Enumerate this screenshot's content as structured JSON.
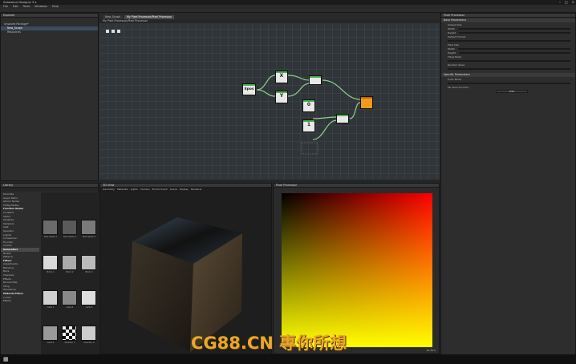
{
  "window": {
    "title": "Substance Designer 5.x"
  },
  "menu": [
    "File",
    "Edit",
    "Tools",
    "Windows",
    "Help"
  ],
  "explorer": {
    "title": "Explorer",
    "items": [
      {
        "label": "Unsaved Package*",
        "selected": false
      },
      {
        "label": "New_Graph",
        "selected": true
      },
      {
        "label": "Resources",
        "selected": false
      }
    ]
  },
  "graph": {
    "tabs": [
      {
        "label": "New_Graph",
        "active": false
      },
      {
        "label": "My Pixel Processor/Pixel Processor",
        "active": true
      }
    ],
    "subtitle": "My Pixel Processor/Pixel Processor",
    "nodes": [
      {
        "label": "$pos",
        "kind": "input"
      },
      {
        "label": "X",
        "kind": "swizzle"
      },
      {
        "label": "Y",
        "kind": "swizzle"
      },
      {
        "label": "0",
        "kind": "constant"
      },
      {
        "label": "1",
        "kind": "constant"
      },
      {
        "label": "",
        "kind": "vector"
      },
      {
        "label": "",
        "kind": "vector"
      },
      {
        "label": "",
        "kind": "output"
      }
    ]
  },
  "properties": {
    "title": "Pixel Processor",
    "sections": [
      {
        "label": "Base Parameters"
      },
      {
        "label": "Specific Parameters"
      }
    ],
    "rows": [
      "Output Size",
      "Width",
      "Height",
      "Output Format",
      "Pixel Size",
      "Width",
      "Height",
      "Tiling Mode",
      "Random Seed"
    ],
    "specific_rows": [
      "Color Mode",
      "Per Pixel Function"
    ],
    "buttons": [
      "Edit"
    ]
  },
  "library": {
    "title": "Library",
    "categories": [
      {
        "label": "Favorites",
        "cat": false,
        "sel": false
      },
      {
        "label": "Graph Items",
        "cat": false,
        "sel": false
      },
      {
        "label": "Atomic Nodes",
        "cat": false,
        "sel": false
      },
      {
        "label": "FxMap Nodes",
        "cat": false,
        "sel": false
      },
      {
        "label": "Function Nodes",
        "cat": true,
        "sel": false
      },
      {
        "label": "Constant",
        "cat": false,
        "sel": false
      },
      {
        "label": "Vector",
        "cat": false,
        "sel": false
      },
      {
        "label": "Variables",
        "cat": false,
        "sel": false
      },
      {
        "label": "Samplers",
        "cat": false,
        "sel": false
      },
      {
        "label": "Cast",
        "cat": false,
        "sel": false
      },
      {
        "label": "Operator",
        "cat": false,
        "sel": false
      },
      {
        "label": "Logical",
        "cat": false,
        "sel": false
      },
      {
        "label": "Comparison",
        "cat": false,
        "sel": false
      },
      {
        "label": "Function",
        "cat": false,
        "sel": false
      },
      {
        "label": "Control",
        "cat": false,
        "sel": false
      },
      {
        "label": "Generators",
        "cat": true,
        "sel": true
      },
      {
        "label": "Noises",
        "cat": false,
        "sel": false
      },
      {
        "label": "Patterns",
        "cat": false,
        "sel": false
      },
      {
        "label": "Filters",
        "cat": true,
        "sel": false
      },
      {
        "label": "Adjustments",
        "cat": false,
        "sel": false
      },
      {
        "label": "Blending",
        "cat": false,
        "sel": false
      },
      {
        "label": "Blurs",
        "cat": false,
        "sel": false
      },
      {
        "label": "Channels",
        "cat": false,
        "sel": false
      },
      {
        "label": "Effects",
        "cat": false,
        "sel": false
      },
      {
        "label": "Normal Map",
        "cat": false,
        "sel": false
      },
      {
        "label": "Tiling",
        "cat": false,
        "sel": false
      },
      {
        "label": "Transforms",
        "cat": false,
        "sel": false
      },
      {
        "label": "Material Filters",
        "cat": true,
        "sel": false
      },
      {
        "label": "1-Click",
        "cat": false,
        "sel": false
      },
      {
        "label": "Effects",
        "cat": false,
        "sel": false
      }
    ],
    "thumbs": [
      "Bnw Spots 1",
      "Bnw Spots 2",
      "Bnw Spots 3",
      "Brick 1",
      "Brick 2",
      "Brick 3",
      "Cells 1",
      "Cells 2",
      "Cells 3",
      "Cells 4",
      "Checker 1",
      "Checker 2"
    ]
  },
  "view3d": {
    "title": "3D View",
    "menu": [
      "Geometry",
      "Materials",
      "Lights",
      "Camera",
      "Environment",
      "Scene",
      "Display",
      "Renderer"
    ]
  },
  "view2d": {
    "title": "Pixel Processor",
    "zoom": "32.30%"
  },
  "watermark": "CG88.CN 專你所想"
}
